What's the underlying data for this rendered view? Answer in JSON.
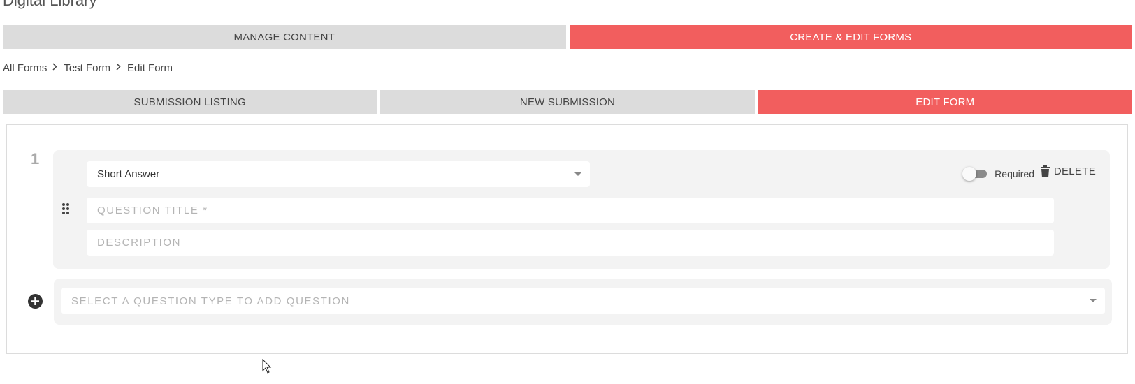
{
  "app": {
    "title": "Digital Library"
  },
  "top_tabs": [
    {
      "label": "MANAGE CONTENT",
      "active": false
    },
    {
      "label": "CREATE & EDIT FORMS",
      "active": true
    }
  ],
  "breadcrumb": [
    "All Forms",
    "Test Form",
    "Edit Form"
  ],
  "sub_tabs": [
    {
      "label": "SUBMISSION LISTING",
      "active": false
    },
    {
      "label": "NEW SUBMISSION",
      "active": false
    },
    {
      "label": "EDIT FORM",
      "active": true
    }
  ],
  "question": {
    "number": "1",
    "type_value": "Short Answer",
    "required_label": "Required",
    "required_on": false,
    "delete_label": "DELETE",
    "title_value": "",
    "title_placeholder": "QUESTION TITLE *",
    "description_value": "",
    "description_placeholder": "DESCRIPTION"
  },
  "add_question": {
    "placeholder": "SELECT A QUESTION TYPE TO ADD QUESTION"
  },
  "icons": {
    "drag": "drag-handle-icon",
    "dropdown": "caret-down-icon",
    "delete": "trash-icon",
    "add": "plus-circle-icon",
    "breadcrumb_separator": "chevron-right-icon"
  },
  "colors": {
    "accent": "#f25e5e",
    "tab_inactive": "#dcdcdc",
    "card_background": "#f3f3f3"
  }
}
